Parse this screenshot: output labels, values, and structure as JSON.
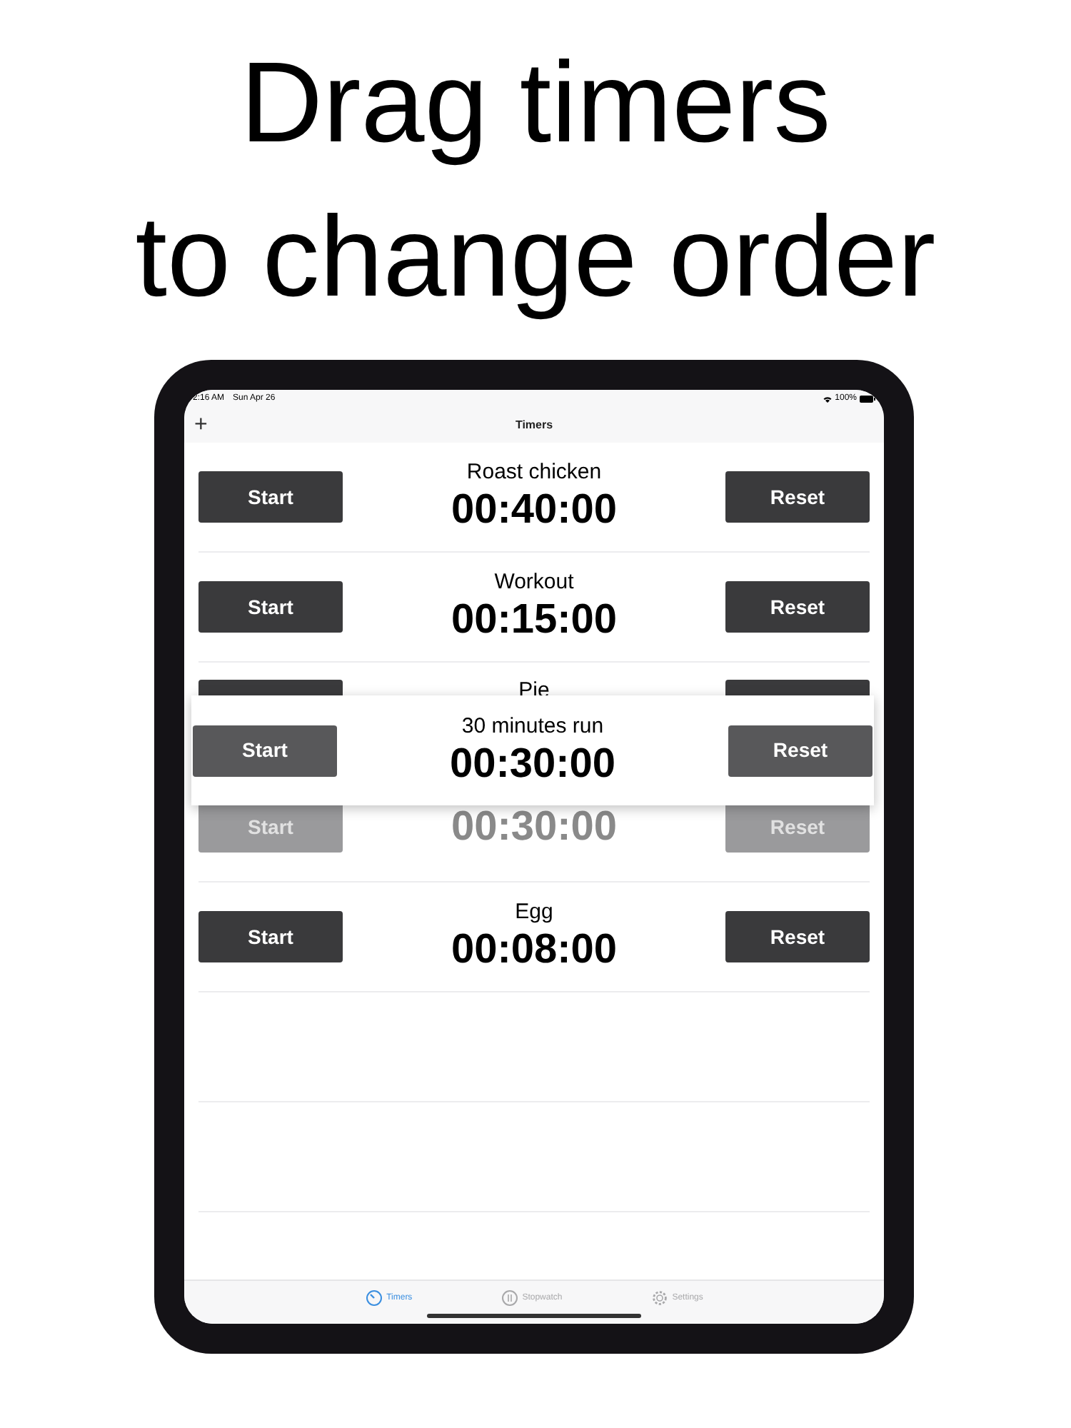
{
  "headline": [
    "Drag timers",
    "to change order"
  ],
  "status_bar": {
    "time": "2:16 AM",
    "date": "Sun Apr 26",
    "battery": "100%"
  },
  "nav": {
    "add": "+",
    "title": "Timers"
  },
  "timers": [
    {
      "kind": "normal",
      "name": "Roast chicken",
      "time": "00:40:00",
      "start": "Start",
      "reset": "Reset"
    },
    {
      "kind": "normal",
      "name": "Workout",
      "time": "00:15:00",
      "start": "Start",
      "reset": "Reset"
    },
    {
      "kind": "covered",
      "name": "Pie"
    },
    {
      "kind": "ghost",
      "time": "00:30:00",
      "start": "Start",
      "reset": "Reset"
    },
    {
      "kind": "normal",
      "name": "Egg",
      "time": "00:08:00",
      "start": "Start",
      "reset": "Reset"
    }
  ],
  "dragging": {
    "name": "30 minutes run",
    "time": "00:30:00",
    "start": "Start",
    "reset": "Reset"
  },
  "tabs": [
    {
      "label": "Timers",
      "selected": true
    },
    {
      "label": "Stopwatch",
      "selected": false
    },
    {
      "label": "Settings",
      "selected": false
    }
  ]
}
